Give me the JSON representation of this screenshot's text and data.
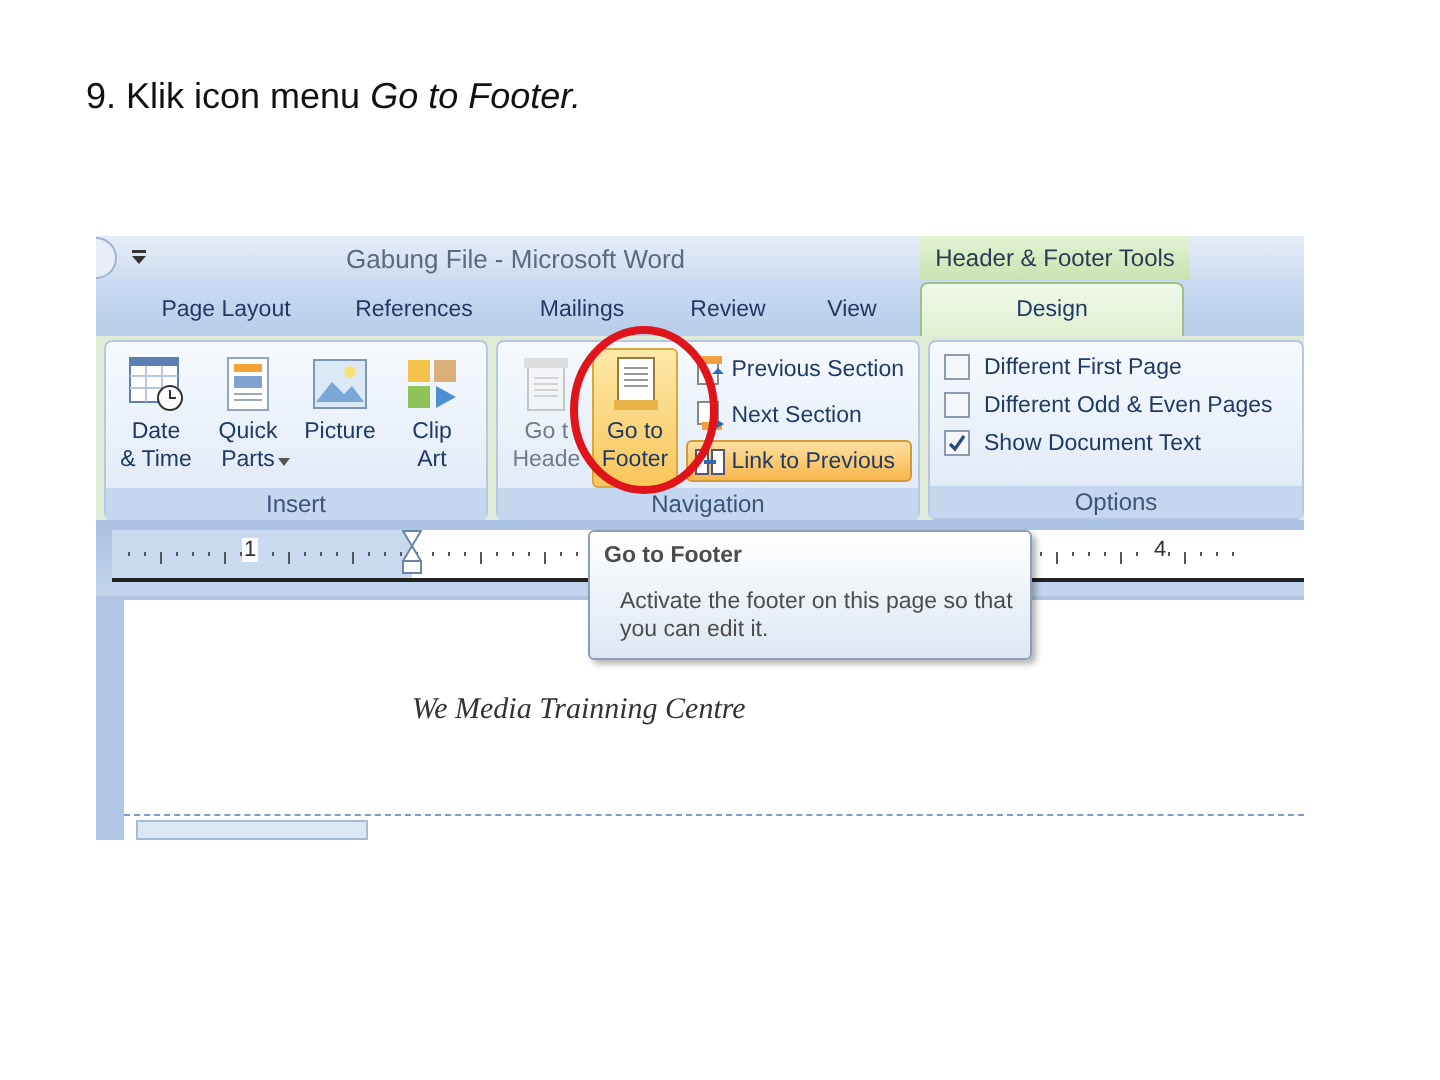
{
  "instruction": "9. Klik icon menu *Go to Footer.*",
  "window": {
    "title": "Gabung File - Microsoft Word",
    "contextual_group": "Header & Footer Tools"
  },
  "tabs": [
    {
      "label": "Page Layout",
      "selected": false
    },
    {
      "label": "References",
      "selected": false
    },
    {
      "label": "Mailings",
      "selected": false
    },
    {
      "label": "Review",
      "selected": false
    },
    {
      "label": "View",
      "selected": false
    },
    {
      "label": "Design",
      "selected": true
    }
  ],
  "ribbon_groups": [
    {
      "label": "Insert",
      "kind": "large",
      "buttons": [
        {
          "label": "Date\n& Time",
          "dropdown": false,
          "highlighted": false,
          "disabled": false
        },
        {
          "label": "Quick\nParts",
          "dropdown": true,
          "highlighted": false,
          "disabled": false
        },
        {
          "label": "Picture",
          "dropdown": false,
          "highlighted": false,
          "disabled": false
        },
        {
          "label": "Clip\nArt",
          "dropdown": false,
          "highlighted": false,
          "disabled": false
        }
      ]
    },
    {
      "label": "Navigation",
      "kind": "navigation",
      "buttons": [
        {
          "label": "Go t\nHeade",
          "dropdown": false,
          "highlighted": false,
          "disabled": true
        },
        {
          "label": "Go to\nFooter",
          "dropdown": false,
          "highlighted": true,
          "disabled": false
        }
      ],
      "small_buttons": [
        {
          "label": "Previous Section",
          "highlighted": false
        },
        {
          "label": "Next Section",
          "highlighted": false
        },
        {
          "label": "Link to Previous",
          "highlighted": true
        }
      ]
    },
    {
      "label": "Options",
      "kind": "options",
      "checkboxes": [
        {
          "label": "Different First Page",
          "checked": false
        },
        {
          "label": "Different Odd & Even Pages",
          "checked": false
        },
        {
          "label": "Show Document Text",
          "checked": true
        }
      ]
    }
  ],
  "ruler": {
    "labels": [
      "1",
      "4"
    ]
  },
  "tooltip": {
    "title": "Go to Footer",
    "body": "Activate the footer on this page so that you can edit it."
  },
  "document": {
    "text": "We Media Trainning Centre"
  }
}
